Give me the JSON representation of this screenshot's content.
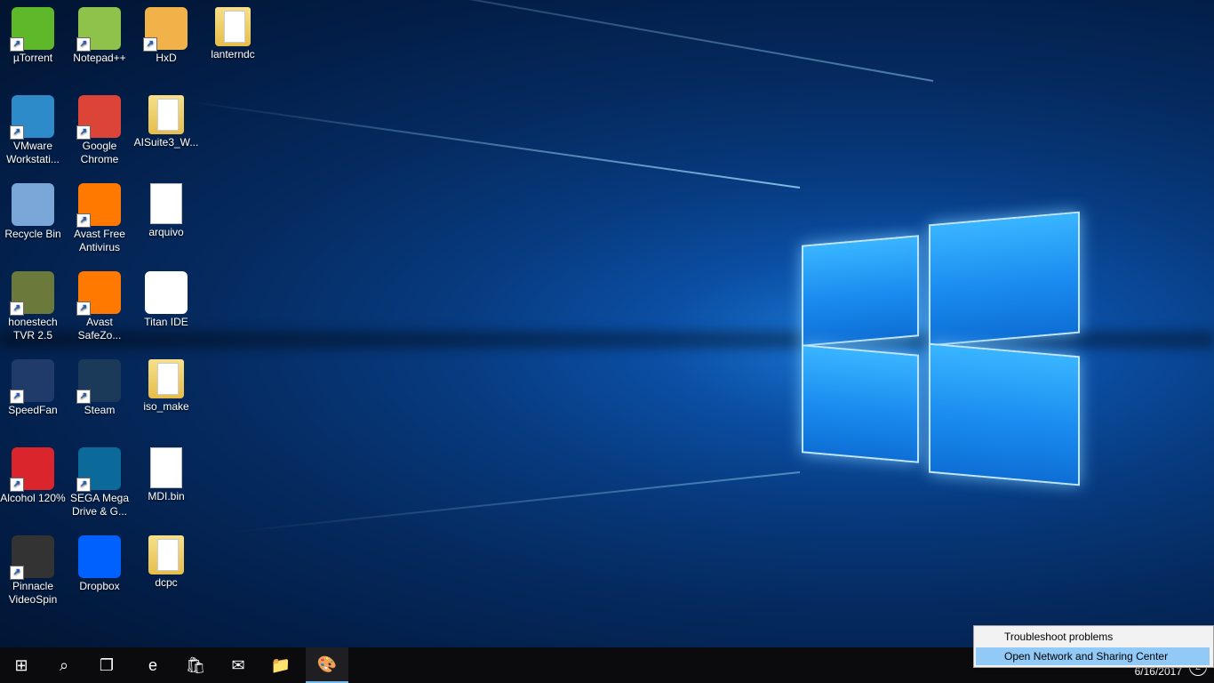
{
  "desktop": {
    "icons": [
      {
        "label": "µTorrent",
        "icon": "utorrent-icon",
        "color": "#5fb829",
        "shortcut": true
      },
      {
        "label": "Notepad++",
        "icon": "notepadpp-icon",
        "color": "#8fc24a",
        "shortcut": true
      },
      {
        "label": "HxD",
        "icon": "hxd-icon",
        "color": "#f1b24a",
        "shortcut": true
      },
      {
        "label": "lanterndc",
        "icon": "folder-icon",
        "color": "#f0d060",
        "shortcut": false
      },
      {
        "label": "VMware Workstati...",
        "icon": "vmware-icon",
        "color": "#2e8bc9",
        "shortcut": true
      },
      {
        "label": "Google Chrome",
        "icon": "chrome-icon",
        "color": "#db4437",
        "shortcut": true
      },
      {
        "label": "AISuite3_W...",
        "icon": "folder-icon",
        "color": "#f0d060",
        "shortcut": false
      },
      {
        "label": "Recycle Bin",
        "icon": "recycle-bin-icon",
        "color": "#7aa7d8",
        "shortcut": false
      },
      {
        "label": "Avast Free Antivirus",
        "icon": "avast-icon",
        "color": "#ff7800",
        "shortcut": true
      },
      {
        "label": "arquivo",
        "icon": "text-file-icon",
        "color": "#ffffff",
        "shortcut": false
      },
      {
        "label": "honestech TVR 2.5",
        "icon": "honestech-icon",
        "color": "#6b7a3a",
        "shortcut": true
      },
      {
        "label": "Avast SafeZo...",
        "icon": "avast-safezone-icon",
        "color": "#ff7800",
        "shortcut": true
      },
      {
        "label": "Titan IDE",
        "icon": "titan-ide-icon",
        "color": "#ffffff",
        "shortcut": false
      },
      {
        "label": "SpeedFan",
        "icon": "speedfan-icon",
        "color": "#203a6a",
        "shortcut": true
      },
      {
        "label": "Steam",
        "icon": "steam-icon",
        "color": "#1b3a5a",
        "shortcut": true
      },
      {
        "label": "iso_make",
        "icon": "folder-icon",
        "color": "#f0d060",
        "shortcut": false
      },
      {
        "label": "Alcohol 120%",
        "icon": "alcohol-icon",
        "color": "#d9252b",
        "shortcut": true
      },
      {
        "label": "SEGA Mega Drive & G...",
        "icon": "sega-icon",
        "color": "#0b6a9a",
        "shortcut": true
      },
      {
        "label": "MDI.bin",
        "icon": "file-icon",
        "color": "#ffffff",
        "shortcut": false
      },
      {
        "label": "Pinnacle VideoSpin",
        "icon": "pinnacle-icon",
        "color": "#333333",
        "shortcut": true
      },
      {
        "label": "Dropbox",
        "icon": "dropbox-icon",
        "color": "#0061fe",
        "shortcut": false
      },
      {
        "label": "dcpc",
        "icon": "folder-icon",
        "color": "#f0d060",
        "shortcut": false
      }
    ]
  },
  "taskbar": {
    "buttons": [
      {
        "name": "start-button",
        "icon": "windows-logo-icon",
        "glyph": "⊞"
      },
      {
        "name": "search-button",
        "icon": "search-icon",
        "glyph": "⌕"
      },
      {
        "name": "task-view-button",
        "icon": "task-view-icon",
        "glyph": "❐"
      },
      {
        "name": "edge-button",
        "icon": "edge-icon",
        "glyph": "e"
      },
      {
        "name": "store-button",
        "icon": "store-icon",
        "glyph": "🛍"
      },
      {
        "name": "mail-button",
        "icon": "mail-icon",
        "glyph": "✉"
      },
      {
        "name": "file-explorer-button",
        "icon": "folder-icon",
        "glyph": "📁"
      },
      {
        "name": "paint-button",
        "icon": "paint-icon",
        "glyph": "🎨"
      }
    ],
    "date": "6/16/2017",
    "notification_count": "2"
  },
  "context_menu": {
    "items": [
      {
        "label": "Troubleshoot problems"
      },
      {
        "label": "Open Network and Sharing Center"
      }
    ]
  }
}
